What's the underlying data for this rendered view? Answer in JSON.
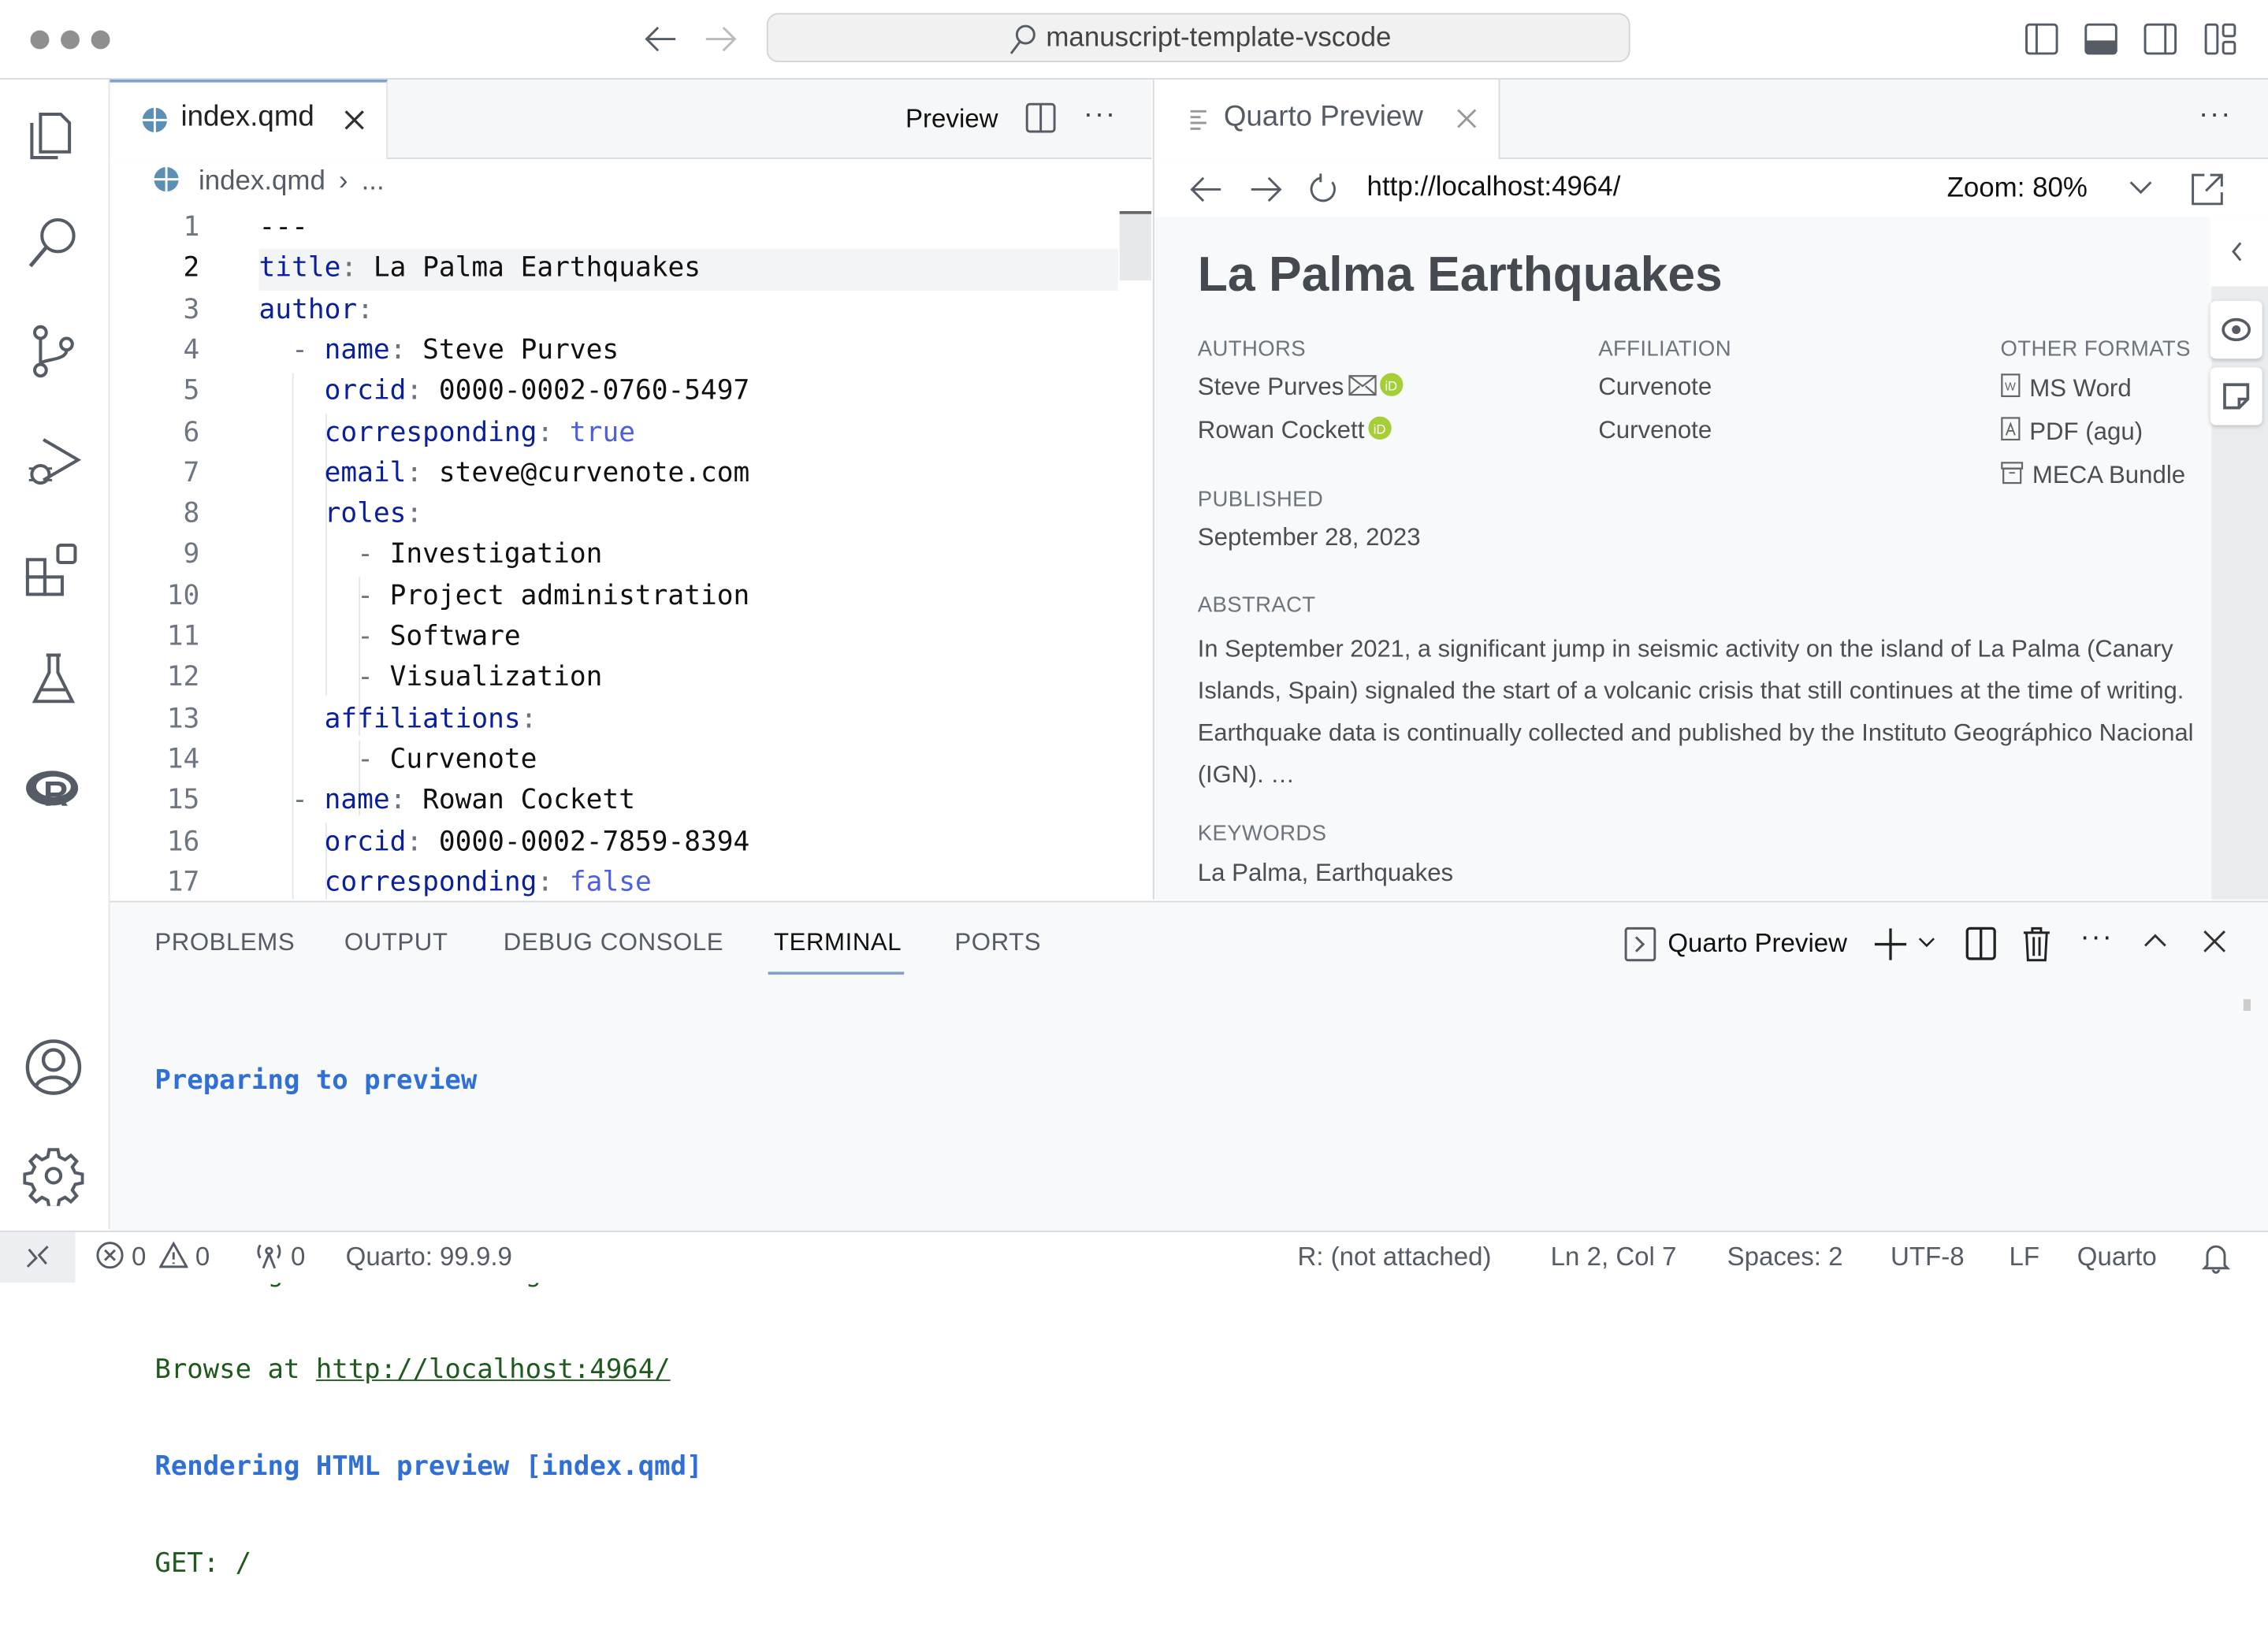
{
  "titlebar": {
    "command_center": "manuscript-template-vscode"
  },
  "editor": {
    "tab_label": "index.qmd",
    "preview_label": "Preview",
    "breadcrumb": [
      "index.qmd",
      "..."
    ],
    "active_line": 2,
    "lines": [
      {
        "n": "1",
        "lead": "",
        "key": "",
        "value": "---",
        "kind": "plain"
      },
      {
        "n": "2",
        "lead": "",
        "key": "title",
        "value": "La Palma Earthquakes",
        "kind": "plain"
      },
      {
        "n": "3",
        "lead": "",
        "key": "author",
        "value": "",
        "kind": "plain"
      },
      {
        "n": "4",
        "lead": "  - ",
        "key": "name",
        "value": "Steve Purves",
        "kind": "plain"
      },
      {
        "n": "5",
        "lead": "    ",
        "key": "orcid",
        "value": "0000-0002-0760-5497",
        "kind": "plain"
      },
      {
        "n": "6",
        "lead": "    ",
        "key": "corresponding",
        "value": "true",
        "kind": "bool"
      },
      {
        "n": "7",
        "lead": "    ",
        "key": "email",
        "value": "steve@curvenote.com",
        "kind": "plain"
      },
      {
        "n": "8",
        "lead": "    ",
        "key": "roles",
        "value": "",
        "kind": "plain"
      },
      {
        "n": "9",
        "lead": "      - ",
        "key": "",
        "value": "Investigation",
        "kind": "plain"
      },
      {
        "n": "10",
        "lead": "      - ",
        "key": "",
        "value": "Project administration",
        "kind": "plain"
      },
      {
        "n": "11",
        "lead": "      - ",
        "key": "",
        "value": "Software",
        "kind": "plain"
      },
      {
        "n": "12",
        "lead": "      - ",
        "key": "",
        "value": "Visualization",
        "kind": "plain"
      },
      {
        "n": "13",
        "lead": "    ",
        "key": "affiliations",
        "value": "",
        "kind": "plain"
      },
      {
        "n": "14",
        "lead": "      - ",
        "key": "",
        "value": "Curvenote",
        "kind": "plain"
      },
      {
        "n": "15",
        "lead": "  - ",
        "key": "name",
        "value": "Rowan Cockett",
        "kind": "plain"
      },
      {
        "n": "16",
        "lead": "    ",
        "key": "orcid",
        "value": "0000-0002-7859-8394",
        "kind": "plain"
      },
      {
        "n": "17",
        "lead": "    ",
        "key": "corresponding",
        "value": "false",
        "kind": "bool"
      }
    ]
  },
  "preview": {
    "tab_label": "Quarto Preview",
    "url": "http://localhost:4964/",
    "zoom": "Zoom: 80%",
    "doc": {
      "title": "La Palma Earthquakes",
      "authors_label": "AUTHORS",
      "affiliation_label": "AFFILIATION",
      "other_formats_label": "OTHER FORMATS",
      "authors": [
        {
          "name": "Steve Purves",
          "affiliation": "Curvenote",
          "email_icon": true
        },
        {
          "name": "Rowan Cockett",
          "affiliation": "Curvenote",
          "email_icon": false
        }
      ],
      "formats": [
        {
          "label": "MS Word",
          "icon": "word-file-icon"
        },
        {
          "label": "PDF (agu)",
          "icon": "pdf-file-icon"
        },
        {
          "label": "MECA Bundle",
          "icon": "archive-icon"
        }
      ],
      "published_label": "PUBLISHED",
      "published": "September 28, 2023",
      "abstract_label": "ABSTRACT",
      "abstract": "In September 2021, a significant jump in seismic activity on the island of La Palma (Canary Islands, Spain) signaled the start of a volcanic crisis that still continues at the time of writing. Earthquake data is continually collected and published by the Instituto Geográphico Nacional (IGN). …",
      "keywords_label": "KEYWORDS",
      "keywords": "La Palma, Earthquakes"
    }
  },
  "panel": {
    "tabs": [
      "PROBLEMS",
      "OUTPUT",
      "DEBUG CONSOLE",
      "TERMINAL",
      "PORTS"
    ],
    "active_tab": "TERMINAL",
    "terminal_name": "Quarto Preview",
    "terminal": {
      "line1": "Preparing to preview",
      "line2": "Watching files for changes",
      "line3_prefix": "Browse at ",
      "line3_link": "http://localhost:4964/",
      "line4": "Rendering HTML preview [index.qmd]",
      "line5": "GET: /"
    }
  },
  "status": {
    "errors": "0",
    "warnings": "0",
    "ports": "0",
    "quarto_version": "Quarto: 99.9.9",
    "r_status": "R: (not attached)",
    "position": "Ln 2, Col 7",
    "spaces": "Spaces: 2",
    "encoding": "UTF-8",
    "eol": "LF",
    "language": "Quarto"
  },
  "colors": {
    "accent": "#7fa3cc",
    "yaml_key": "#0a1f9c",
    "yaml_bool": "#4b5fe0",
    "terminal_blue": "#2f6fd6",
    "terminal_green": "#1e5a1e",
    "orcid": "#a6ce39"
  }
}
